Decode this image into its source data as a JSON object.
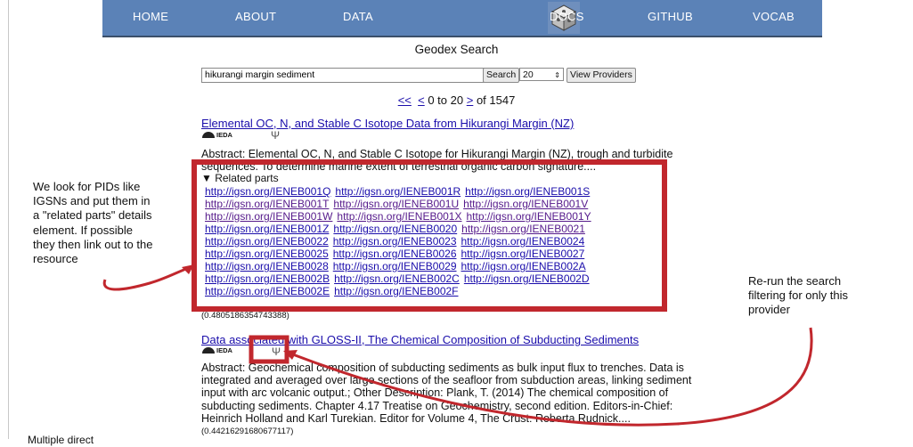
{
  "nav": {
    "items": [
      "HOME",
      "ABOUT",
      "DATA",
      "DOCS",
      "GITHUB",
      "VOCAB"
    ],
    "logo_icon": "geodex-cube-logo-icon"
  },
  "page": {
    "heading": "Geodex Search"
  },
  "search": {
    "query": "hikurangi margin sediment",
    "search_label": "Search",
    "count_value": "20",
    "providers_label": "View Providers"
  },
  "pager": {
    "first": "<<",
    "prev": "<",
    "range": "0 to 20",
    "next": ">",
    "total": "of 1547"
  },
  "results": [
    {
      "title": "Elemental OC, N, and Stable C Isotope Data from Hikurangi Margin (NZ)",
      "provider": "IEDA",
      "provider_sub": "INTERDISCIPLINARY EARTH DATA ALLIANCE",
      "abstract": "Abstract: Elemental OC, N, and Stable C Isotope for Hikurangi Margin (NZ), trough and turbidite sequences. To determine marine extent of terrestrial organic carbon signature....",
      "details_label": "▼ Related parts",
      "related_parts": [
        [
          "http://igsn.org/IENEB001Q",
          "http://igsn.org/IENEB001R",
          "http://igsn.org/IENEB001S"
        ],
        [
          "http://igsn.org/IENEB001T",
          "http://igsn.org/IENEB001U",
          "http://igsn.org/IENEB001V"
        ],
        [
          "http://igsn.org/IENEB001W",
          "http://igsn.org/IENEB001X",
          "http://igsn.org/IENEB001Y"
        ],
        [
          "http://igsn.org/IENEB001Z",
          "http://igsn.org/IENEB0020",
          "http://igsn.org/IENEB0021"
        ],
        [
          "http://igsn.org/IENEB0022",
          "http://igsn.org/IENEB0023",
          "http://igsn.org/IENEB0024"
        ],
        [
          "http://igsn.org/IENEB0025",
          "http://igsn.org/IENEB0026",
          "http://igsn.org/IENEB0027"
        ],
        [
          "http://igsn.org/IENEB0028",
          "http://igsn.org/IENEB0029",
          "http://igsn.org/IENEB002A"
        ],
        [
          "http://igsn.org/IENEB002B",
          "http://igsn.org/IENEB002C",
          "http://igsn.org/IENEB002D"
        ],
        [
          "http://igsn.org/IENEB002E",
          "http://igsn.org/IENEB002F"
        ]
      ],
      "score": "(0.4805186354743388)"
    },
    {
      "title": "Data associated with GLOSS-II, The Chemical Composition of Subducting Sediments",
      "provider": "IEDA",
      "provider_sub": "INTERDISCIPLINARY EARTH DATA ALLIANCE",
      "abstract_lines": [
        "Abstract: Geochemical composition of subducting sediments as bulk input flux to trenches. Data is",
        "integrated and averaged over large sections of the seafloor from subduction areas, linking sediment",
        "input with arc volcanic output.; Other Description: Plank, T. (2014) The chemical composition of",
        "subducting sediments. Chapter 4.17 Treatise on Geochemistry, second edition. Editors-in-Chief:",
        "Heinrich Holland and Karl Turekian. Editor for Volume 4, The Crust: Roberta Rudnick...."
      ],
      "score": "(0.44216291680677117)"
    }
  ],
  "annotations": {
    "left": [
      "We look for PIDs like",
      "IGSNs and put them in",
      "a \"related parts\" details",
      "element.   If possible",
      "they then link out to the",
      "resource"
    ],
    "right": [
      "Re-run the search",
      "filtering for only this",
      "provider"
    ],
    "bottom": "Multiple direct"
  },
  "colors": {
    "nav": "#5b82b7",
    "highlight": "#c1272d",
    "link": "#1a0dab",
    "visited": "#551a8b"
  }
}
